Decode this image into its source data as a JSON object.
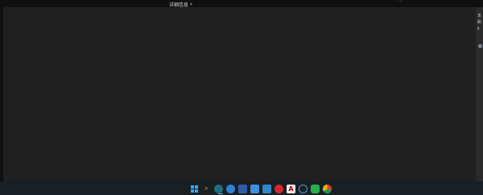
{
  "window": {
    "title": "详细信息",
    "title_suffix": "*",
    "top_right_text": "..."
  },
  "right_panel": {
    "line1": "本",
    "line2": "和",
    "line3": "§"
  },
  "taskbar": {
    "icons": [
      {
        "name": "windows-start-icon"
      },
      {
        "name": "search-icon"
      },
      {
        "name": "browser-icon"
      },
      {
        "name": "app-circle-icon"
      },
      {
        "name": "mail-icon"
      },
      {
        "name": "photos-icon"
      },
      {
        "name": "media-icon"
      },
      {
        "name": "netease-music-icon"
      },
      {
        "name": "adobe-icon"
      },
      {
        "name": "search-round-icon"
      },
      {
        "name": "wechat-icon"
      },
      {
        "name": "chrome-icon"
      }
    ]
  },
  "colors": {
    "panel": "#202020",
    "background": "#101418",
    "taskbar": "#1a1f24"
  }
}
